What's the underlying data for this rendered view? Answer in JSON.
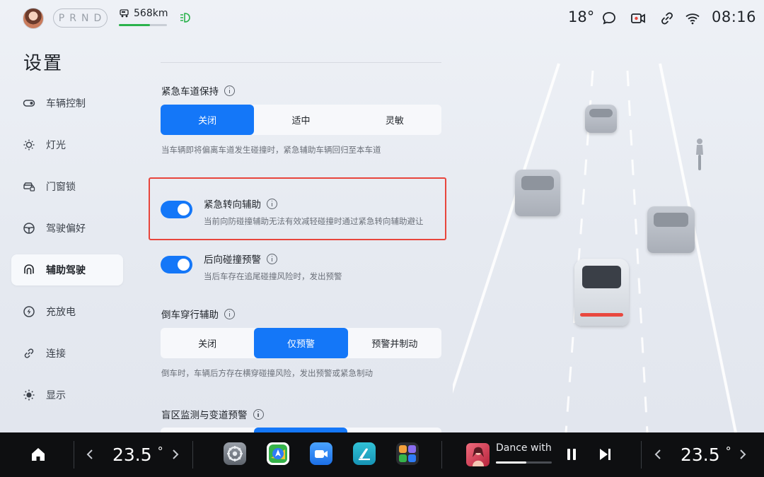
{
  "status": {
    "gears": [
      "P",
      "R",
      "N",
      "D"
    ],
    "active_gear": "",
    "range": "568km",
    "battery_level": 0.65,
    "temperature": "18°",
    "time": "08:16",
    "icons": [
      "avatar",
      "car-icon",
      "headlight-icon",
      "message-icon",
      "dashcam-icon",
      "link-icon",
      "wifi-icon"
    ]
  },
  "sidebar": {
    "title": "设置",
    "items": [
      {
        "label": "车辆控制",
        "icon": "toggle-icon"
      },
      {
        "label": "灯光",
        "icon": "sun-icon"
      },
      {
        "label": "门窗锁",
        "icon": "car-lock-icon"
      },
      {
        "label": "驾驶偏好",
        "icon": "steering-wheel-icon"
      },
      {
        "label": "辅助驾驶",
        "icon": "assist-icon",
        "active": true
      },
      {
        "label": "充放电",
        "icon": "charge-icon"
      },
      {
        "label": "连接",
        "icon": "link-icon"
      },
      {
        "label": "显示",
        "icon": "brightness-icon"
      }
    ]
  },
  "settings": {
    "lane_keep": {
      "label": "紧急车道保持",
      "options": [
        "关闭",
        "适中",
        "灵敏"
      ],
      "selected": "关闭",
      "desc": "当车辆即将偏离车道发生碰撞时，紧急辅助车辆回归至本车道"
    },
    "steer_assist": {
      "label": "紧急转向辅助",
      "enabled": true,
      "desc": "当前向防碰撞辅助无法有效减轻碰撞时通过紧急转向辅助避让"
    },
    "rear_warning": {
      "label": "后向碰撞预警",
      "enabled": true,
      "desc": "当后车存在追尾碰撞风险时，发出预警"
    },
    "reverse_cross": {
      "label": "倒车穿行辅助",
      "options": [
        "关闭",
        "仅预警",
        "预警并制动"
      ],
      "selected": "仅预警",
      "desc": "倒车时，车辆后方存在横穿碰撞风险，发出预警或紧急制动"
    },
    "blind_spot": {
      "label": "盲区监测与变道预警"
    }
  },
  "dock": {
    "left_temp": "23.5",
    "right_temp": "23.5",
    "deg": "°",
    "song": "Dance with",
    "apps": [
      "settings-app",
      "navigation-app",
      "video-call-app",
      "drive-app",
      "app-group"
    ]
  },
  "colors": {
    "accent": "#1477f8",
    "highlight_border": "#e8453c",
    "dock_bg": "#0e0f11"
  }
}
